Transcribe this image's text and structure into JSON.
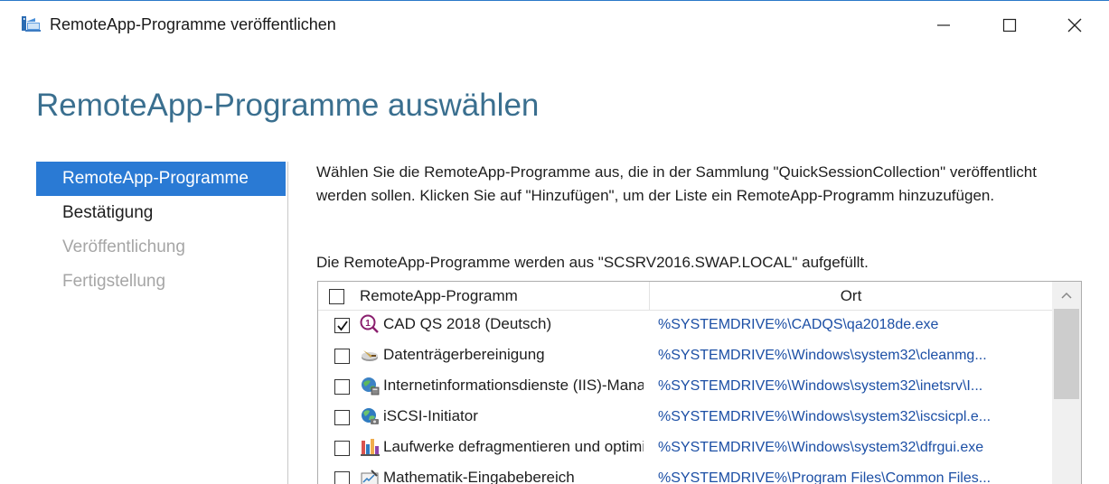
{
  "window": {
    "title": "RemoteApp-Programme veröffentlichen"
  },
  "page": {
    "title": "RemoteApp-Programme auswählen"
  },
  "nav": {
    "items": [
      {
        "label": "RemoteApp-Programme",
        "state": "selected"
      },
      {
        "label": "Bestätigung",
        "state": "enabled"
      },
      {
        "label": "Veröffentlichung",
        "state": "disabled"
      },
      {
        "label": "Fertigstellung",
        "state": "disabled"
      }
    ]
  },
  "content": {
    "description": "Wählen Sie die RemoteApp-Programme aus, die in der Sammlung \"QuickSessionCollection\" veröffentlicht werden sollen. Klicken Sie auf \"Hinzufügen\", um der Liste ein RemoteApp-Programm hinzuzufügen.",
    "source_text": "Die RemoteApp-Programme werden aus \"SCSRV2016.SWAP.LOCAL\" aufgefüllt."
  },
  "table": {
    "columns": [
      "RemoteApp-Programm",
      "Ort"
    ],
    "header_checked": false,
    "rows": [
      {
        "name": "CAD QS 2018 (Deutsch)",
        "location": "%SYSTEMDRIVE%\\CADQS\\qa2018de.exe",
        "checked": true,
        "icon": "cad-qs-icon"
      },
      {
        "name": "Datenträgerbereinigung",
        "location": "%SYSTEMDRIVE%\\Windows\\system32\\cleanmg...",
        "checked": false,
        "icon": "disk-cleanup-icon"
      },
      {
        "name": "Internetinformationsdienste (IIS)-Manager",
        "location": "%SYSTEMDRIVE%\\Windows\\system32\\inetsrv\\I...",
        "checked": false,
        "icon": "iis-manager-icon"
      },
      {
        "name": "iSCSI-Initiator",
        "location": "%SYSTEMDRIVE%\\Windows\\system32\\iscsicpl.e...",
        "checked": false,
        "icon": "iscsi-globe-icon"
      },
      {
        "name": "Laufwerke defragmentieren und optimieren",
        "location": "%SYSTEMDRIVE%\\Windows\\system32\\dfrgui.exe",
        "checked": false,
        "icon": "defrag-icon"
      },
      {
        "name": "Mathematik-Eingabebereich",
        "location": "%SYSTEMDRIVE%\\Program Files\\Common Files...",
        "checked": false,
        "icon": "math-input-icon"
      }
    ]
  }
}
